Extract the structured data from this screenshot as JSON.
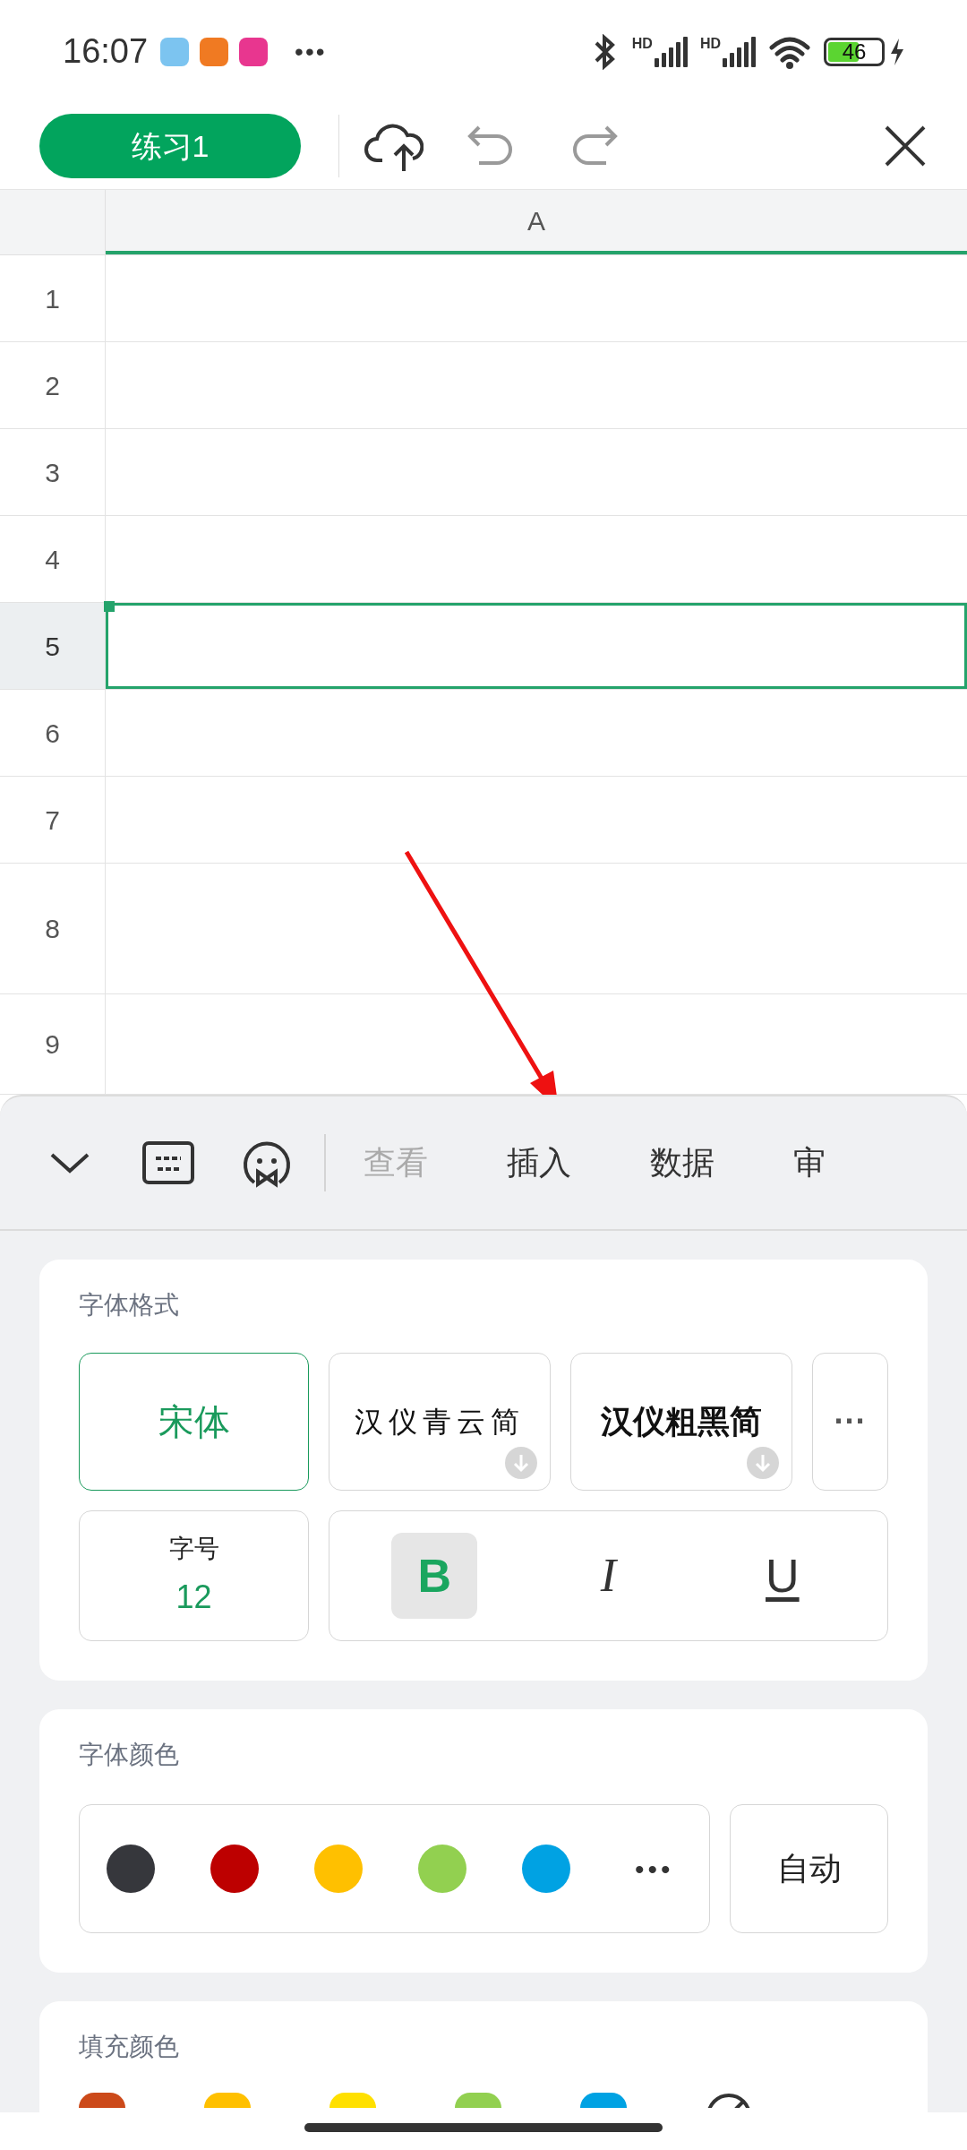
{
  "status_bar": {
    "time": "16:07",
    "notification_icons": [
      {
        "color": "#7cc4f0"
      },
      {
        "color": "#f07a22"
      },
      {
        "color": "#e8368f"
      }
    ],
    "more": "•••",
    "network_labels": [
      "HD",
      "HD"
    ],
    "battery": "46"
  },
  "title_bar": {
    "document_name": "练习1"
  },
  "sheet": {
    "column": "A",
    "rows": [
      {
        "label": "1",
        "selected": false
      },
      {
        "label": "2",
        "selected": false
      },
      {
        "label": "3",
        "selected": false
      },
      {
        "label": "4",
        "selected": false
      },
      {
        "label": "5",
        "selected": true
      },
      {
        "label": "6",
        "selected": false
      },
      {
        "label": "7",
        "selected": false
      },
      {
        "label": "8",
        "selected": false
      },
      {
        "label": "9",
        "selected": false
      }
    ]
  },
  "toolbar": {
    "tabs": [
      {
        "label": "查看",
        "dimmed": true
      },
      {
        "label": "插入",
        "dimmed": false
      },
      {
        "label": "数据",
        "dimmed": false
      },
      {
        "label": "审",
        "dimmed": false
      }
    ]
  },
  "font_format": {
    "title": "字体格式",
    "fonts": [
      {
        "label": "宋体",
        "kind": "plain",
        "selected": true,
        "downloadable": false
      },
      {
        "label": "汉仪青云简",
        "kind": "script",
        "selected": false,
        "downloadable": true
      },
      {
        "label": "汉仪粗黑简",
        "kind": "heavy",
        "selected": false,
        "downloadable": true
      }
    ],
    "more": "···",
    "size_label": "字号",
    "size_value": "12",
    "styles": [
      {
        "kind": "bold",
        "label": "B",
        "on": true
      },
      {
        "kind": "italic",
        "label": "I",
        "on": false
      },
      {
        "kind": "underline",
        "label": "U",
        "on": false
      }
    ]
  },
  "font_color": {
    "title": "字体颜色",
    "colors": [
      {
        "color": "#36373c"
      },
      {
        "color": "#bd0000"
      },
      {
        "color": "#ffc000"
      },
      {
        "color": "#92d050"
      },
      {
        "color": "#00a2e3"
      }
    ],
    "more": "•••",
    "auto_label": "自动"
  },
  "fill_color": {
    "title": "填充颜色",
    "colors": [
      {
        "color": "#cc4a1a"
      },
      {
        "color": "#ffc000"
      },
      {
        "color": "#ffe000"
      },
      {
        "color": "#92d050"
      },
      {
        "color": "#00a2e3"
      }
    ]
  }
}
